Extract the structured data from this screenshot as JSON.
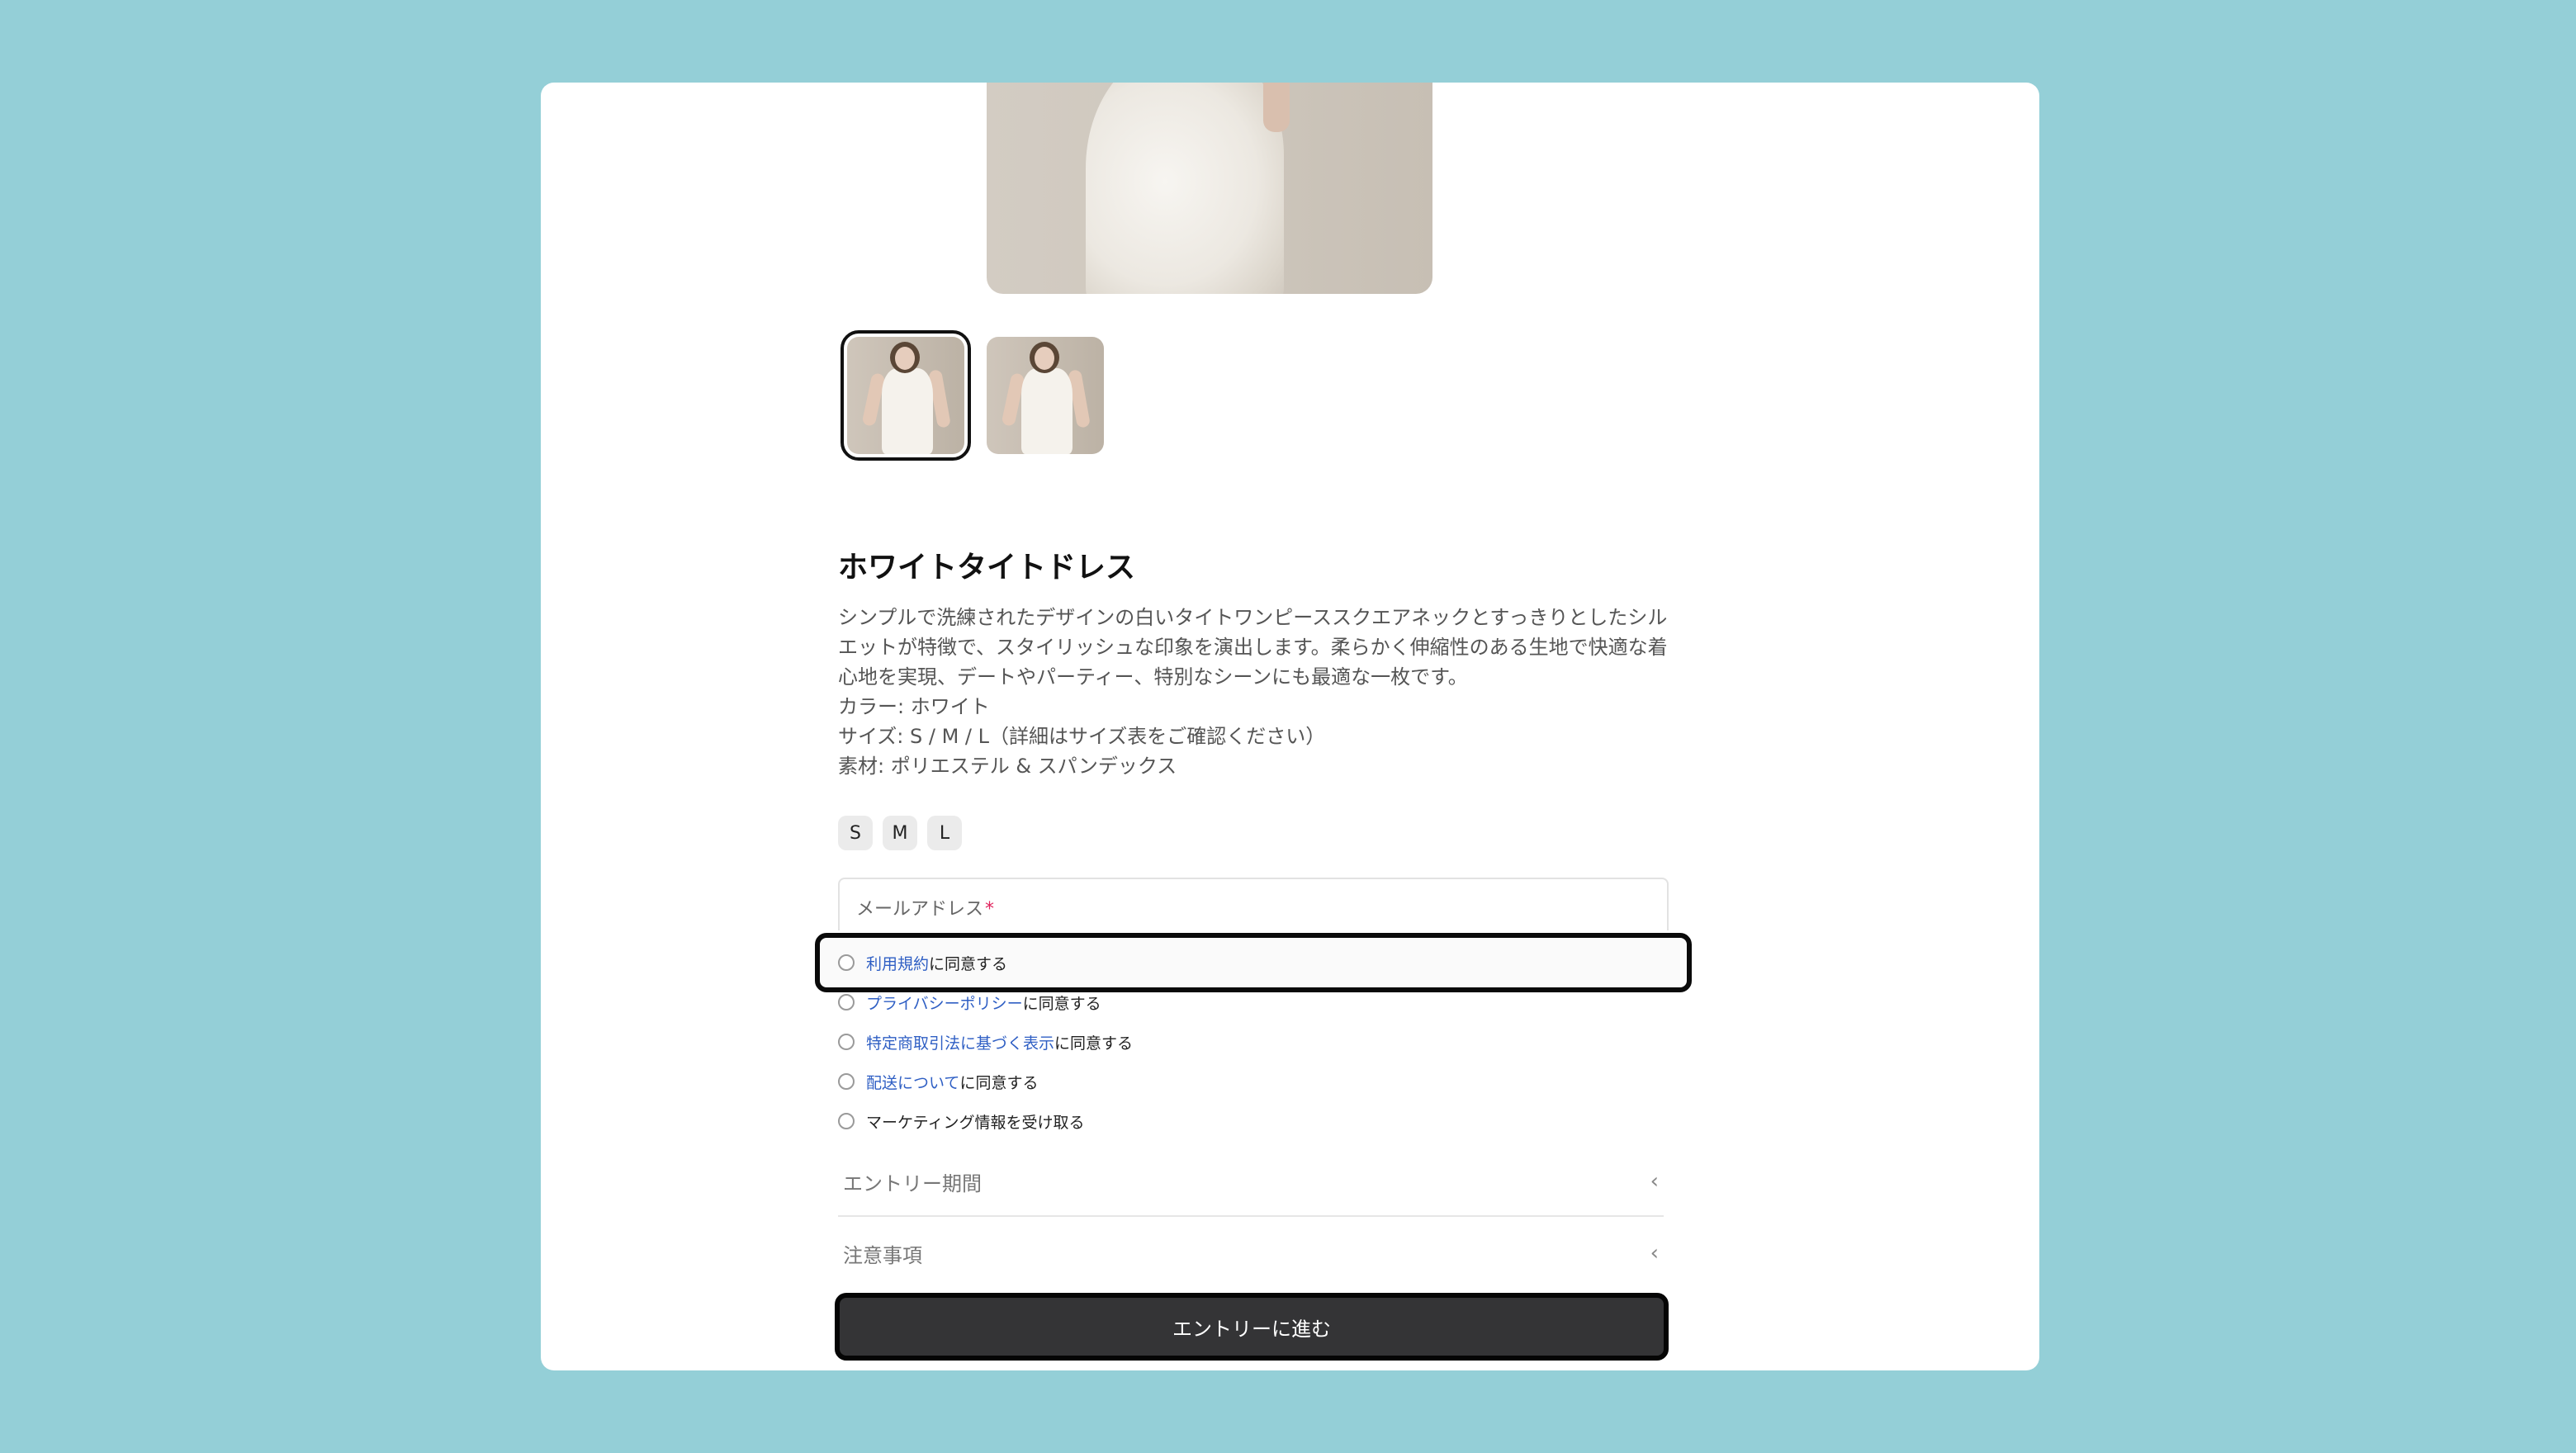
{
  "product": {
    "title": "ホワイトタイトドレス",
    "description_lines": [
      "シンプルで洗練されたデザインの白いタイトワンピーススクエアネックとすっきりとしたシル",
      "エットが特徴で、スタイリッシュな印象を演出します。柔らかく伸縮性のある生地で快適な着",
      "心地を実現、デートやパーティー、特別なシーンにも最適な一枚です。",
      "カラー: ホワイト",
      "サイズ: S / M / L（詳細はサイズ表をご確認ください）",
      "素材: ポリエステル & スパンデックス"
    ],
    "sizes": [
      "S",
      "M",
      "L"
    ]
  },
  "form": {
    "email_label": "メールアドレス",
    "required_mark": "*",
    "checkboxes": [
      {
        "link": "利用規約",
        "suffix": "に同意する"
      },
      {
        "link": "プライバシーポリシー",
        "suffix": "に同意する"
      },
      {
        "link": "特定商取引法に基づく表示",
        "suffix": "に同意する"
      },
      {
        "link": "配送について",
        "suffix": "に同意する"
      },
      {
        "link": "",
        "suffix": "マーケティング情報を受け取る"
      }
    ]
  },
  "accordions": [
    {
      "label": "エントリー期間",
      "icon": "chevron-left-icon"
    },
    {
      "label": "注意事項",
      "icon": "chevron-left-icon"
    }
  ],
  "cta_label": "エントリーに進む",
  "colors": {
    "background": "#94cfd7",
    "card": "#ffffff",
    "link": "#2f5fc4",
    "cta": "#343436",
    "required": "#e0245e"
  }
}
